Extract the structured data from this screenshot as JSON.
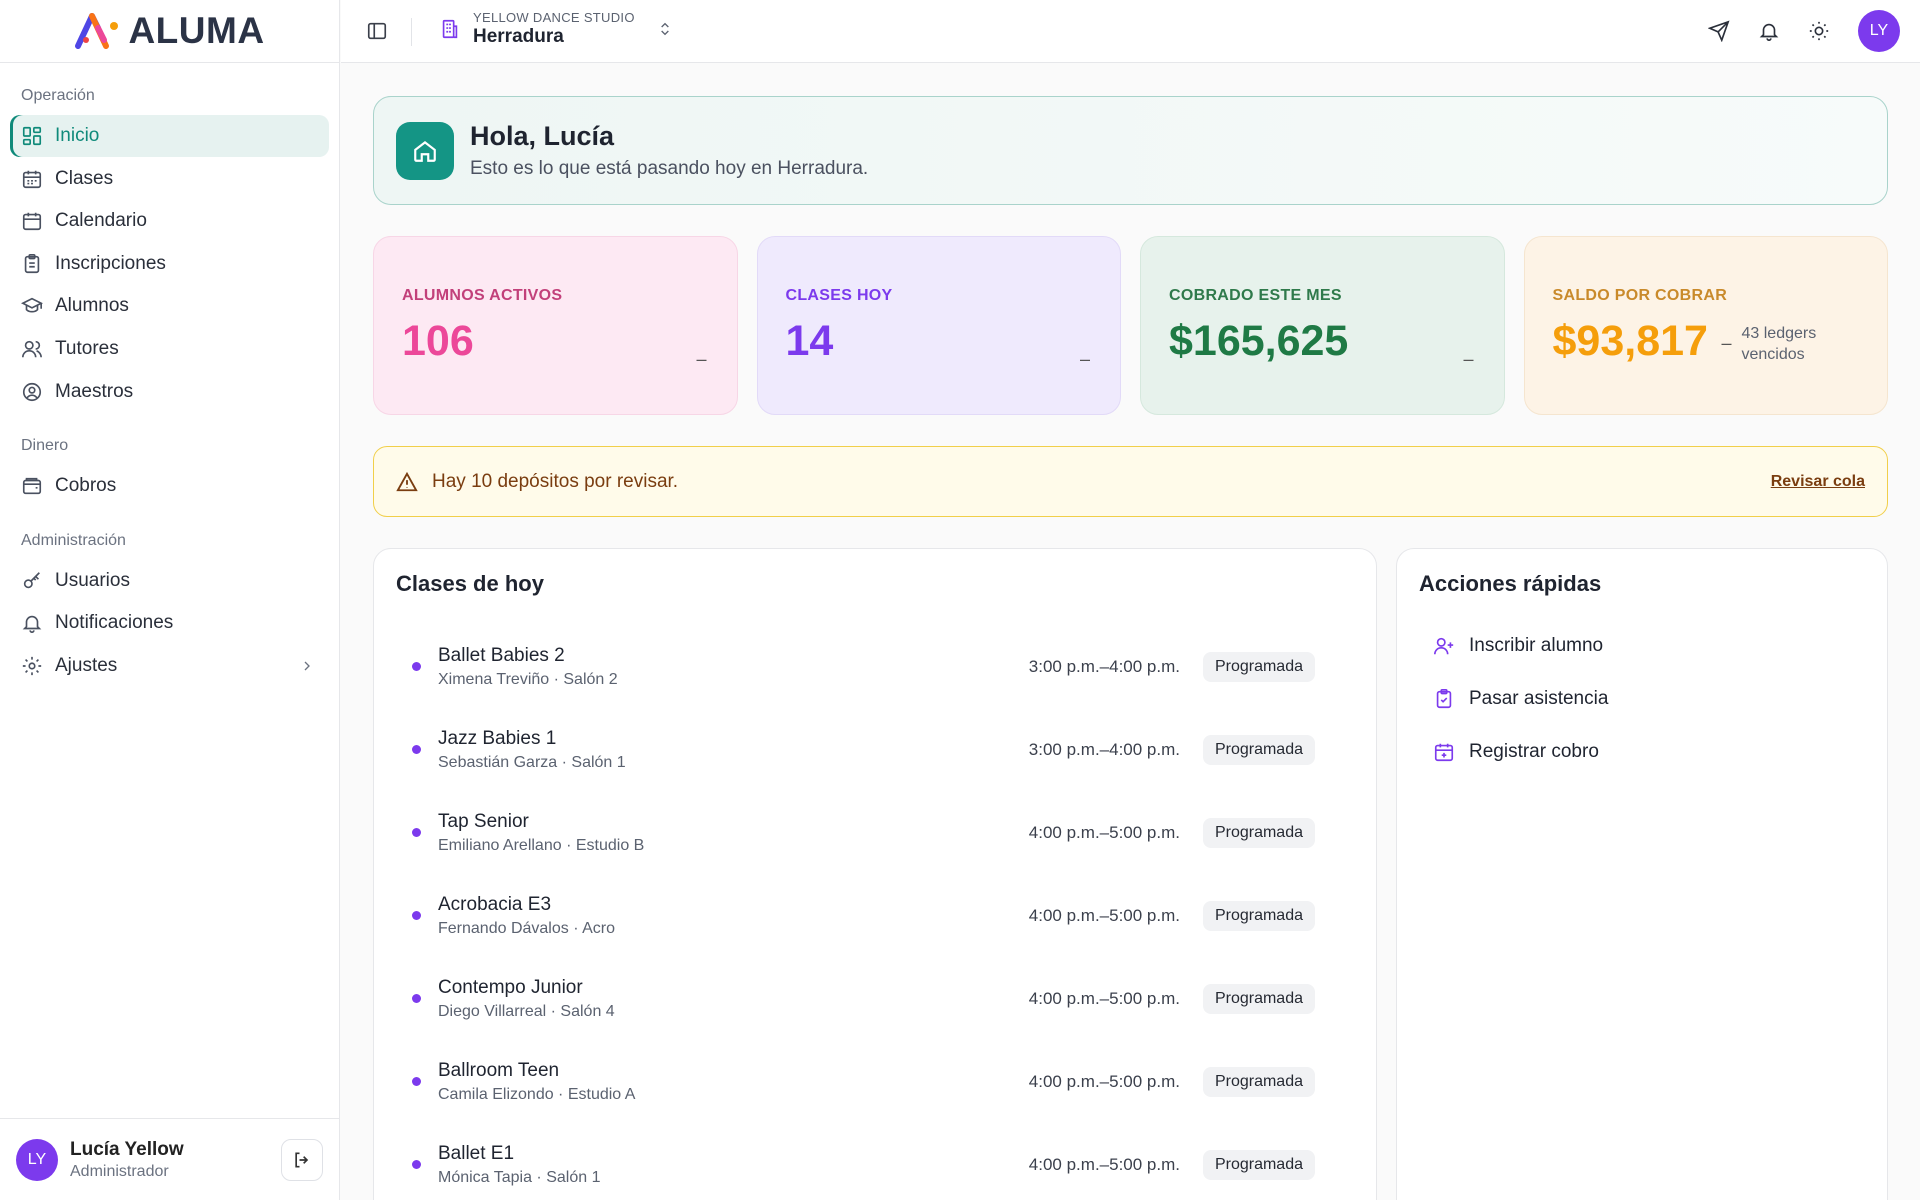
{
  "app": {
    "name": "ALUMA"
  },
  "topbar": {
    "studio_label": "YELLOW DANCE STUDIO",
    "studio_name": "Herradura",
    "avatar_initials": "LY"
  },
  "sidebar": {
    "sections": [
      {
        "heading": "Operación",
        "items": [
          "Inicio",
          "Clases",
          "Calendario",
          "Inscripciones",
          "Alumnos",
          "Tutores",
          "Maestros"
        ]
      },
      {
        "heading": "Dinero",
        "items": [
          "Cobros"
        ]
      },
      {
        "heading": "Administración",
        "items": [
          "Usuarios",
          "Notificaciones",
          "Ajustes"
        ]
      }
    ],
    "active": "Inicio"
  },
  "user": {
    "name": "Lucía Yellow",
    "role": "Administrador",
    "initials": "LY"
  },
  "hero": {
    "title": "Hola, Lucía",
    "subtitle": "Esto es lo que está pasando hoy en Herradura."
  },
  "stats": [
    {
      "label": "ALUMNOS ACTIVOS",
      "value": "106",
      "trend": "–"
    },
    {
      "label": "CLASES HOY",
      "value": "14",
      "trend": "–"
    },
    {
      "label": "COBRADO ESTE MES",
      "value": "$165,625",
      "trend": "–"
    },
    {
      "label": "SALDO POR COBRAR",
      "value": "$93,817",
      "trend": "–",
      "note": "43 ledgers vencidos"
    }
  ],
  "alert": {
    "text": "Hay 10 depósitos por revisar.",
    "link": "Revisar cola"
  },
  "classes": {
    "title": "Clases de hoy",
    "items": [
      {
        "name": "Ballet Babies 2",
        "sub": "Ximena Treviño · Salón 2",
        "time": "3:00 p.m.–4:00 p.m.",
        "status": "Programada"
      },
      {
        "name": "Jazz Babies 1",
        "sub": "Sebastián Garza · Salón 1",
        "time": "3:00 p.m.–4:00 p.m.",
        "status": "Programada"
      },
      {
        "name": "Tap Senior",
        "sub": "Emiliano Arellano · Estudio B",
        "time": "4:00 p.m.–5:00 p.m.",
        "status": "Programada"
      },
      {
        "name": "Acrobacia E3",
        "sub": "Fernando Dávalos · Acro",
        "time": "4:00 p.m.–5:00 p.m.",
        "status": "Programada"
      },
      {
        "name": "Contempo Junior",
        "sub": "Diego Villarreal · Salón 4",
        "time": "4:00 p.m.–5:00 p.m.",
        "status": "Programada"
      },
      {
        "name": "Ballroom Teen",
        "sub": "Camila Elizondo · Estudio A",
        "time": "4:00 p.m.–5:00 p.m.",
        "status": "Programada"
      },
      {
        "name": "Ballet E1",
        "sub": "Mónica Tapia · Salón 1",
        "time": "4:00 p.m.–5:00 p.m.",
        "status": "Programada"
      }
    ]
  },
  "quick": {
    "title": "Acciones rápidas",
    "items": [
      "Inscribir alumno",
      "Pasar asistencia",
      "Registrar cobro"
    ]
  },
  "colors": {
    "accent": "#0f8a7a",
    "purple": "#7c3aed",
    "pink": "#ec4899",
    "green": "#1f7a45",
    "orange": "#f59e0b"
  }
}
